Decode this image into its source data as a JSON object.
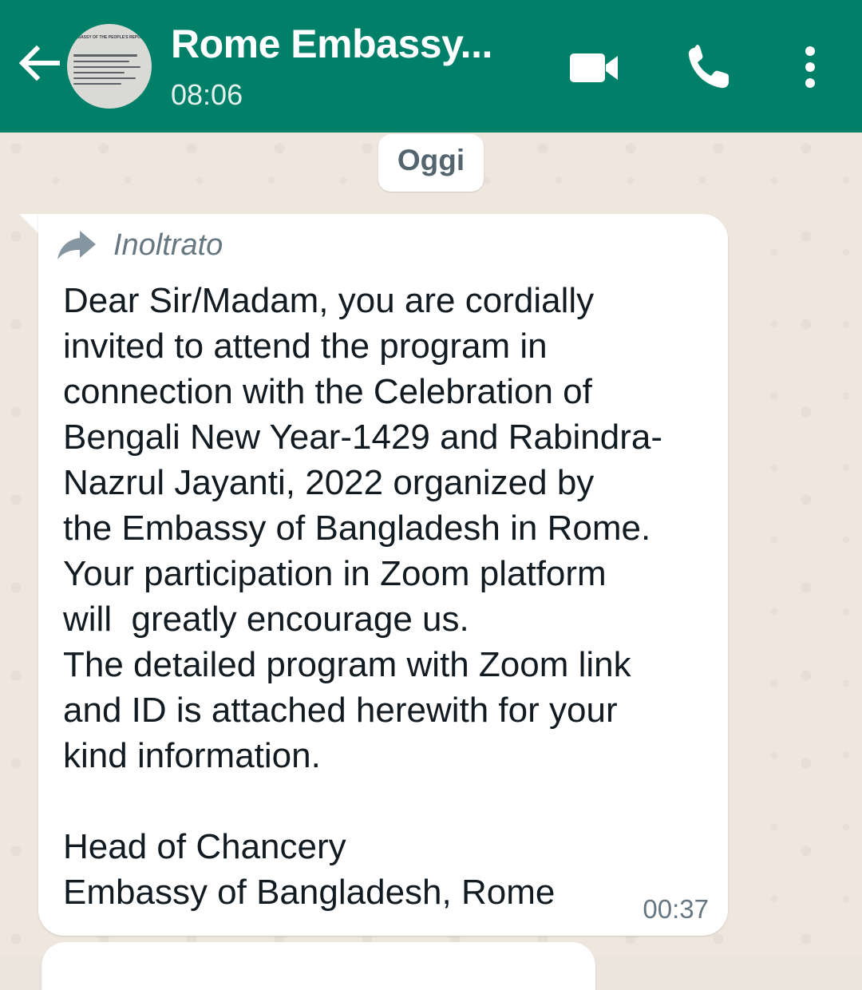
{
  "header": {
    "contact_name": "Rome Embassy...",
    "last_seen": "08:06",
    "avatar_text": "EMBASSY OF THE PEOPLE'S REPUBLIC OF BANGLADESH",
    "background_color": "#008069",
    "icons": {
      "back": "arrow-left-icon",
      "video": "video-camera-icon",
      "call": "phone-icon",
      "menu": "more-vertical-icon"
    }
  },
  "chat": {
    "date_chip": "Oggi",
    "message": {
      "forwarded_label": "Inoltrato",
      "forward_icon": "forward-arrow-icon",
      "text": "Dear Sir/Madam, you are cordially\ninvited to attend the program in\nconnection with the Celebration of\nBengali New Year-1429 and Rabindra-\nNazrul Jayanti, 2022 organized by\nthe Embassy of Bangladesh in Rome.\nYour participation in Zoom platform\nwill  greatly encourage us.\nThe detailed program with Zoom link\nand ID is attached herewith for your\nkind information.\n\nHead of Chancery\nEmbassy of Bangladesh, Rome",
      "time": "00:37"
    }
  }
}
